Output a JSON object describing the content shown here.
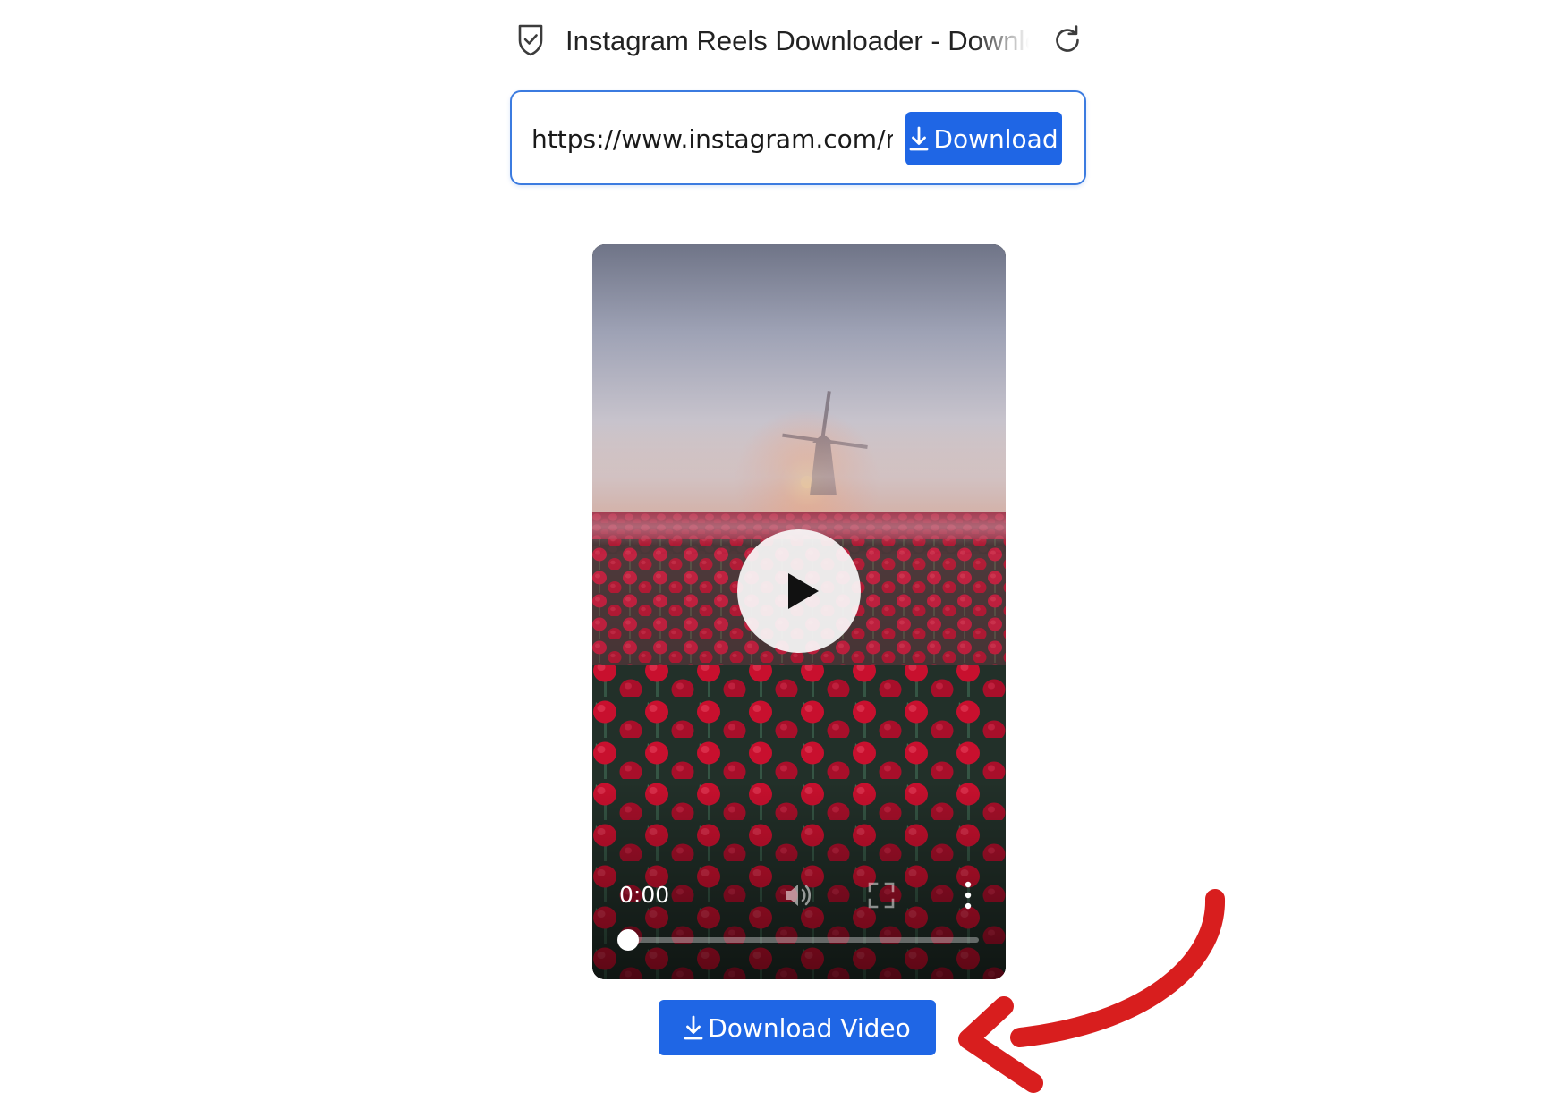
{
  "browser": {
    "tab_title": "Instagram Reels Downloader - Download",
    "security_icon": "shield-check-icon",
    "reload_icon": "reload-icon"
  },
  "form": {
    "url_value": "https://www.instagram.com/r",
    "download_label": "Download",
    "download_icon": "download-icon"
  },
  "player": {
    "time": "0:00",
    "progress": 0,
    "icons": [
      "play-icon",
      "volume-icon",
      "fullscreen-icon",
      "more-vertical-icon"
    ]
  },
  "download_video": {
    "label": "Download Video",
    "icon": "download-icon"
  },
  "colors": {
    "primary_button": "#1f66e5",
    "input_border": "#3b7be0",
    "annotation_arrow": "#d81e1e"
  }
}
